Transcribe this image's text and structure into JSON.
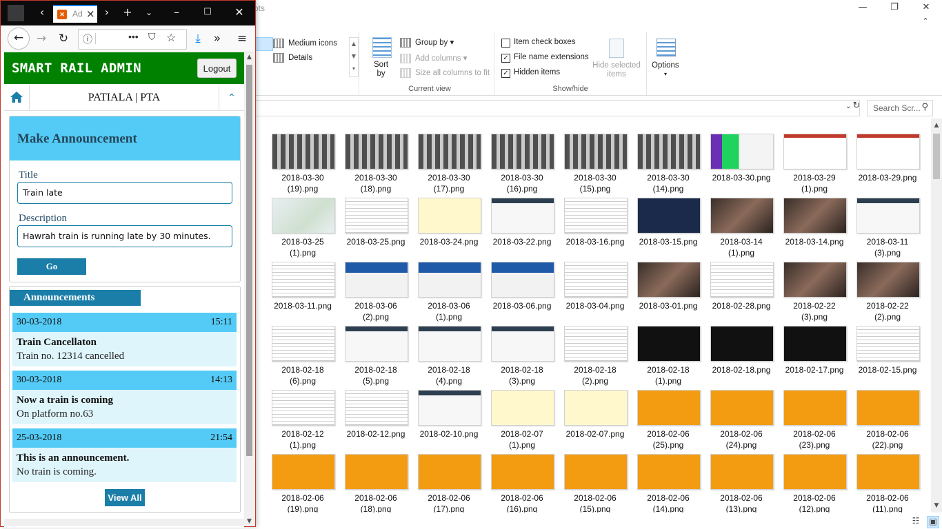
{
  "explorer": {
    "title": "ots",
    "window_controls": [
      "—",
      "❐",
      "✕"
    ],
    "ribbon": {
      "layout": {
        "items": [
          "Medium icons",
          "Details"
        ],
        "icons": [
          "medium-icons-icon",
          "details-icon"
        ]
      },
      "current_view": {
        "sort_by": "Sort\nby",
        "group_by": "Group by",
        "add_columns": "Add columns",
        "size_columns": "Size all columns to fit",
        "label": "Current view"
      },
      "show_hide": {
        "item_check_boxes": {
          "label": "Item check boxes",
          "checked": false
        },
        "file_name_extensions": {
          "label": "File name extensions",
          "checked": true
        },
        "hidden_items": {
          "label": "Hidden items",
          "checked": true
        },
        "hide_selected": "Hide selected\nitems",
        "label": "Show/hide"
      },
      "options": "Options"
    },
    "search_placeholder": "Search Scr...",
    "files": [
      {
        "name": "2018-03-30\n(19).png",
        "thumb": "t-grid"
      },
      {
        "name": "2018-03-30\n(18).png",
        "thumb": "t-grid"
      },
      {
        "name": "2018-03-30\n(17).png",
        "thumb": "t-grid"
      },
      {
        "name": "2018-03-30\n(16).png",
        "thumb": "t-grid"
      },
      {
        "name": "2018-03-30\n(15).png",
        "thumb": "t-grid"
      },
      {
        "name": "2018-03-30\n(14).png",
        "thumb": "t-grid"
      },
      {
        "name": "2018-03-30.png",
        "thumb": "t-green"
      },
      {
        "name": "2018-03-29\n(1).png",
        "thumb": "t-ppt"
      },
      {
        "name": "2018-03-29.png",
        "thumb": "t-ppt"
      },
      {
        "name": "2018-03-25\n(1).png",
        "thumb": "t-map"
      },
      {
        "name": "2018-03-25.png",
        "thumb": "t-doc"
      },
      {
        "name": "2018-03-24.png",
        "thumb": "t-yellow"
      },
      {
        "name": "2018-03-22.png",
        "thumb": "t-web"
      },
      {
        "name": "2018-03-16.png",
        "thumb": "t-doc"
      },
      {
        "name": "2018-03-15.png",
        "thumb": "t-navy"
      },
      {
        "name": "2018-03-14\n(1).png",
        "thumb": "t-photo"
      },
      {
        "name": "2018-03-14.png",
        "thumb": "t-photo"
      },
      {
        "name": "2018-03-11\n(3).png",
        "thumb": "t-web"
      },
      {
        "name": "2018-03-11.png",
        "thumb": "t-doc"
      },
      {
        "name": "2018-03-06\n(2).png",
        "thumb": "t-blue"
      },
      {
        "name": "2018-03-06\n(1).png",
        "thumb": "t-blue"
      },
      {
        "name": "2018-03-06.png",
        "thumb": "t-blue"
      },
      {
        "name": "2018-03-04.png",
        "thumb": "t-doc"
      },
      {
        "name": "2018-03-01.png",
        "thumb": "t-photo"
      },
      {
        "name": "2018-02-28.png",
        "thumb": "t-doc"
      },
      {
        "name": "2018-02-22\n(3).png",
        "thumb": "t-photo"
      },
      {
        "name": "2018-02-22\n(2).png",
        "thumb": "t-photo"
      },
      {
        "name": "2018-02-18\n(6).png",
        "thumb": "t-doc"
      },
      {
        "name": "2018-02-18\n(5).png",
        "thumb": "t-web"
      },
      {
        "name": "2018-02-18\n(4).png",
        "thumb": "t-web"
      },
      {
        "name": "2018-02-18\n(3).png",
        "thumb": "t-web"
      },
      {
        "name": "2018-02-18\n(2).png",
        "thumb": "t-doc"
      },
      {
        "name": "2018-02-18\n(1).png",
        "thumb": "t-dark"
      },
      {
        "name": "2018-02-18.png",
        "thumb": "t-dark"
      },
      {
        "name": "2018-02-17.png",
        "thumb": "t-dark"
      },
      {
        "name": "2018-02-15.png",
        "thumb": "t-doc"
      },
      {
        "name": "2018-02-12\n(1).png",
        "thumb": "t-doc"
      },
      {
        "name": "2018-02-12.png",
        "thumb": "t-doc"
      },
      {
        "name": "2018-02-10.png",
        "thumb": "t-web"
      },
      {
        "name": "2018-02-07\n(1).png",
        "thumb": "t-yellow"
      },
      {
        "name": "2018-02-07.png",
        "thumb": "t-yellow"
      },
      {
        "name": "2018-02-06\n(25).png",
        "thumb": "t-orange"
      },
      {
        "name": "2018-02-06\n(24).png",
        "thumb": "t-orange"
      },
      {
        "name": "2018-02-06\n(23).png",
        "thumb": "t-orange"
      },
      {
        "name": "2018-02-06\n(22).png",
        "thumb": "t-orange"
      },
      {
        "name": "2018-02-06\n(19).png",
        "thumb": "t-orange"
      },
      {
        "name": "2018-02-06\n(18).png",
        "thumb": "t-orange"
      },
      {
        "name": "2018-02-06\n(17).png",
        "thumb": "t-orange"
      },
      {
        "name": "2018-02-06\n(16).png",
        "thumb": "t-orange"
      },
      {
        "name": "2018-02-06\n(15).png",
        "thumb": "t-orange"
      },
      {
        "name": "2018-02-06\n(14).png",
        "thumb": "t-orange"
      },
      {
        "name": "2018-02-06\n(13).png",
        "thumb": "t-orange"
      },
      {
        "name": "2018-02-06\n(12).png",
        "thumb": "t-orange"
      },
      {
        "name": "2018-02-06\n(11).png",
        "thumb": "t-orange"
      }
    ]
  },
  "browser": {
    "tab_title": "Ad",
    "url_placeholder": "",
    "app": {
      "brand": "SMART RAIL ADMIN",
      "logout": "Logout",
      "station": "PATIALA | PTA",
      "form": {
        "heading": "Make Announcement",
        "title_label": "Title",
        "title_value": "Train late",
        "description_label": "Description",
        "description_value": "Hawrah train is running late by 30 minutes.",
        "submit": "Go"
      },
      "announcements": {
        "heading": "Announcements",
        "items": [
          {
            "date": "30-03-2018",
            "time": "15:11",
            "title": "Train Cancellaton",
            "desc": "Train no. 12314 cancelled"
          },
          {
            "date": "30-03-2018",
            "time": "14:13",
            "title": "Now a train is coming",
            "desc": "On platform no.63"
          },
          {
            "date": "25-03-2018",
            "time": "21:54",
            "title": "This is an announcement.",
            "desc": "No train is coming."
          }
        ],
        "view_all": "View All"
      }
    },
    "colors": {
      "header_green": "#008200",
      "accent_blue": "#1b7ea8",
      "light_blue": "#54cbf6",
      "pale_blue": "#dff5fc"
    }
  }
}
